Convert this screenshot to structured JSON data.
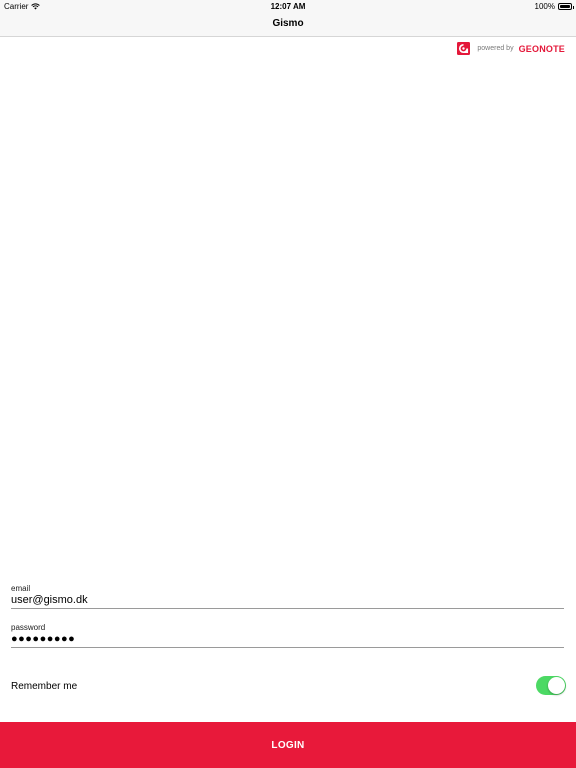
{
  "status_bar": {
    "carrier": "Carrier",
    "time": "12:07 AM",
    "battery": "100%",
    "wifi_icon": "wifi-icon",
    "battery_icon": "battery-icon"
  },
  "nav": {
    "title": "Gismo"
  },
  "branding": {
    "powered_by": "powered by",
    "brand": "GEONOTE",
    "logo_icon": "geonote-logo-icon",
    "brand_color": "#e4183a"
  },
  "form": {
    "email_label": "email",
    "email_value": "user@gismo.dk",
    "password_label": "password",
    "password_value": "●●●●●●●●●",
    "remember_label": "Remember me",
    "remember_on": true,
    "toggle_color": "#4cd964"
  },
  "login": {
    "label": "LOGIN",
    "color": "#e8193a"
  }
}
